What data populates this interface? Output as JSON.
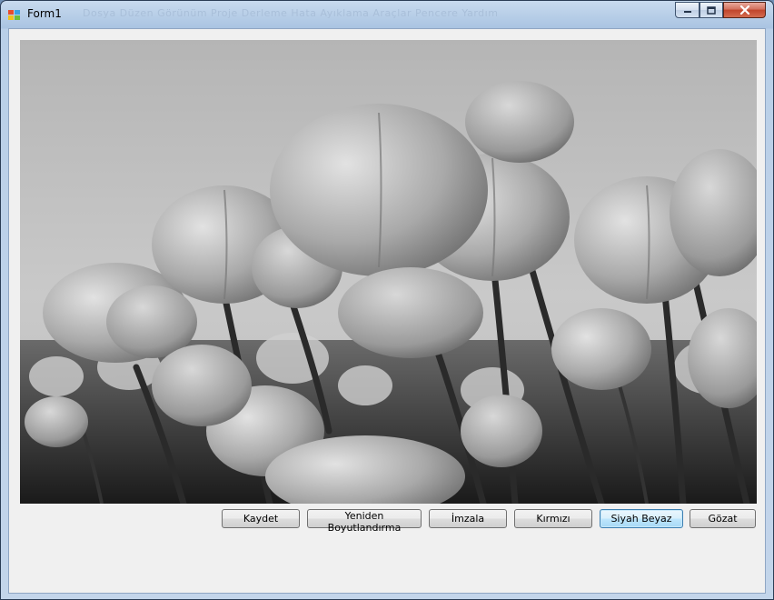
{
  "window": {
    "title": "Form1"
  },
  "titlebar": {
    "ghost_text": "Dosya   Düzen   Görünüm   Proje   Derleme   Hata Ayıklama   Araçlar   Pencere   Yardım"
  },
  "controls": {
    "minimize_icon": "minimize-icon",
    "maximize_icon": "maximize-icon",
    "close_icon": "close-icon"
  },
  "picture": {
    "subject": "grayscale-tulips-photo"
  },
  "buttons": {
    "save": "Kaydet",
    "resize": "Yeniden Boyutlandırma",
    "sign": "İmzala",
    "red": "Kırmızı",
    "grayscale": "Siyah Beyaz",
    "browse": "Gözat"
  },
  "colors": {
    "titlebar": "#aac4e2",
    "client": "#f0f0f0",
    "focus_button": "#3c7fb1"
  }
}
